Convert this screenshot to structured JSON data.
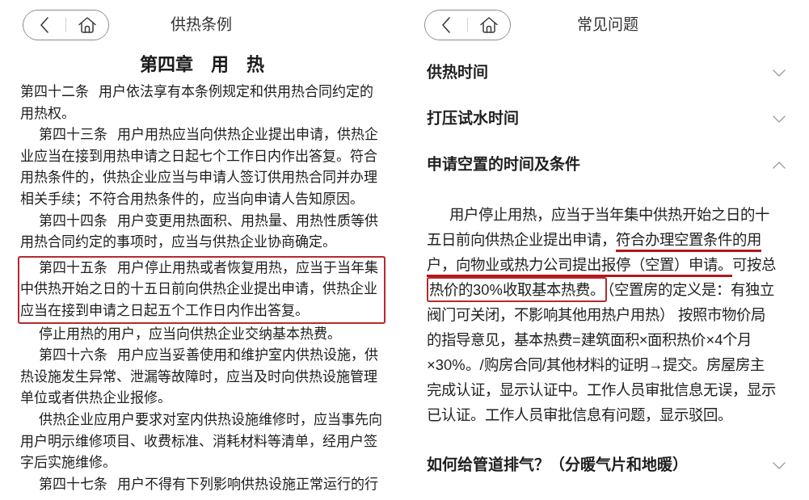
{
  "regulation_page": {
    "title": "供热条例",
    "chapter_heading": "第四章　用　热",
    "paragraphs": [
      {
        "text": "第四十二条 用户依法享有本条例规定和供用热合同约定的用热权。",
        "indented": false,
        "boxed": false
      },
      {
        "text": "第四十三条 用户用热应当向供热企业提出申请，供热企业应当在接到用热申请之日起七个工作日内作出答复。符合用热条件的，供热企业应当与申请人签订供用热合同并办理相关手续；不符合用热条件的，应当向申请人告知原因。",
        "indented": true,
        "boxed": false
      },
      {
        "text": "第四十四条 用户变更用热面积、用热量、用热性质等供用热合同约定的事项时，应当与供热企业协商确定。",
        "indented": true,
        "boxed": false
      },
      {
        "text": "第四十五条 用户停止用热或者恢复用热，应当于当年集中供热开始之日的十五日前向供热企业提出申请，供热企业应当在接到申请之日起五个工作日内作出答复。",
        "indented": true,
        "boxed": true
      },
      {
        "text": "停止用热的用户，应当向供热企业交纳基本热费。",
        "indented": true,
        "boxed": false
      },
      {
        "text": "第四十六条 用户应当妥善使用和维护室内供热设施，供热设施发生异常、泄漏等故障时，应当及时向供热设施管理单位或者供热企业报修。",
        "indented": true,
        "boxed": false
      },
      {
        "text": "供热企业应用户要求对室内供热设施维修时，应当事先向用户明示维修项目、收费标准、消耗材料等清单，经用户签字后实施维修。",
        "indented": true,
        "boxed": false
      },
      {
        "text": "第四十七条 用户不得有下列影响供热设施正常运行的行",
        "indented": true,
        "boxed": false
      }
    ]
  },
  "faq_page": {
    "title": "常见问题",
    "items": [
      {
        "question": "供热时间",
        "expanded": false
      },
      {
        "question": "打压试水时间",
        "expanded": false
      },
      {
        "question": "申请空置的时间及条件",
        "expanded": true,
        "answer": [
          {
            "text": "用户停止用热，应当于当年集中供热开始之日的十五日前向供热企业提出申请，",
            "underlined": false,
            "boxed": false
          },
          {
            "text": "符合办理空置条件的用户，向物业或热力公司提出报停（空置）申请。",
            "underlined": true,
            "boxed": false
          },
          {
            "text": "可按总",
            "underlined": false,
            "boxed": false
          },
          {
            "text": "热价的30%收取基本热费。",
            "underlined": false,
            "boxed": true
          },
          {
            "text": "（空置房的定义是：有独立阀门可关闭，不影响其他用热户用热） 按照市物价局的指导意见，基本热费=建筑面积×面积热价×4个月×30%。/购房合同/其他材料的证明→提交。房屋房主完成认证，显示认证中。工作人员审批信息无误，显示已认证。工作人员审批信息有问题，显示驳回。",
            "underlined": false,
            "boxed": false
          }
        ]
      },
      {
        "question": "如何给管道排气？（分暖气片和地暖）",
        "expanded": false
      }
    ]
  }
}
